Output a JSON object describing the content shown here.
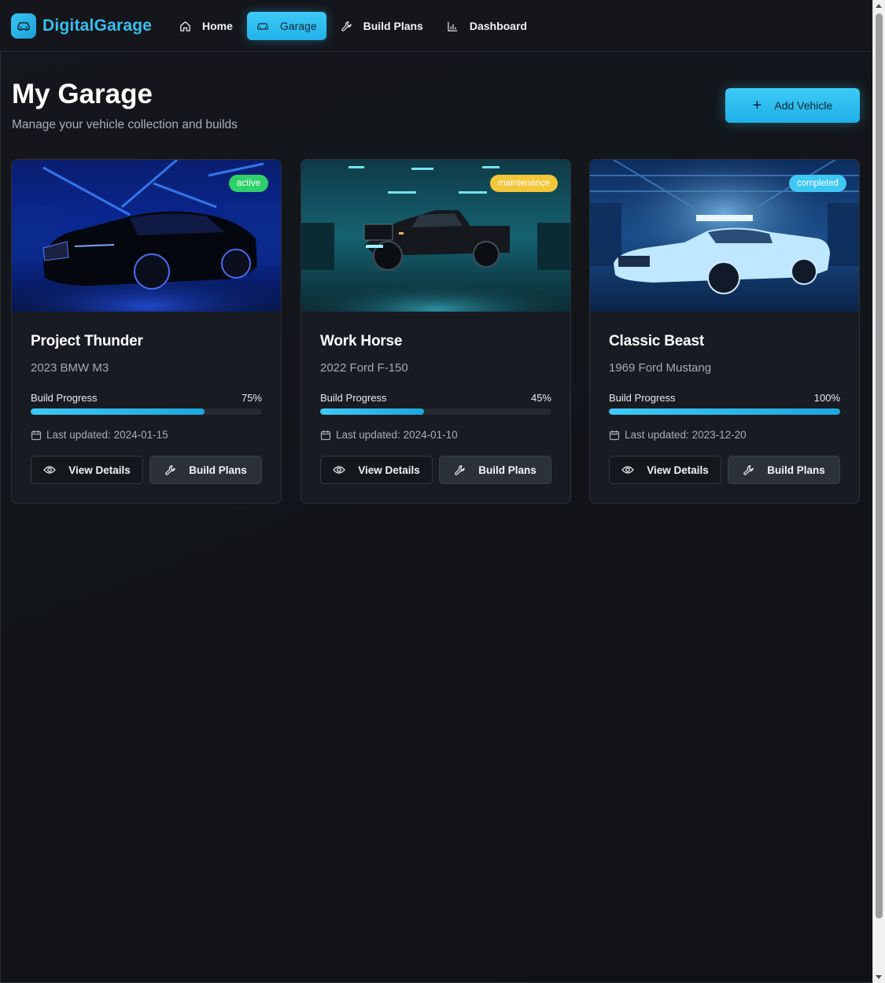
{
  "brand": {
    "name": "DigitalGarage"
  },
  "nav": [
    {
      "label": "Home",
      "icon": "home-icon",
      "active": false
    },
    {
      "label": "Garage",
      "icon": "car-icon",
      "active": true
    },
    {
      "label": "Build Plans",
      "icon": "wrench-icon",
      "active": false
    },
    {
      "label": "Dashboard",
      "icon": "bar-chart-icon",
      "active": false
    }
  ],
  "header": {
    "title": "My Garage",
    "subtitle": "Manage your vehicle collection and builds",
    "add_label": "Add Vehicle"
  },
  "vehicles": [
    {
      "name": "Project Thunder",
      "model": "2023 BMW M3",
      "status": "active",
      "status_color": "#2fd06a",
      "progress_label": "Build Progress",
      "progress": 75,
      "progress_text": "75%",
      "updated": "Last updated: 2024-01-15",
      "view_label": "View Details",
      "plans_label": "Build Plans"
    },
    {
      "name": "Work Horse",
      "model": "2022 Ford F-150",
      "status": "maintenance",
      "status_color": "#f4c63a",
      "progress_label": "Build Progress",
      "progress": 45,
      "progress_text": "45%",
      "updated": "Last updated: 2024-01-10",
      "view_label": "View Details",
      "plans_label": "Build Plans"
    },
    {
      "name": "Classic Beast",
      "model": "1969 Ford Mustang",
      "status": "completed",
      "status_color": "#3ec8f4",
      "progress_label": "Build Progress",
      "progress": 100,
      "progress_text": "100%",
      "updated": "Last updated: 2023-12-20",
      "view_label": "View Details",
      "plans_label": "Build Plans"
    }
  ],
  "colors": {
    "accent": "#38c6f4",
    "background": "#13161b"
  }
}
